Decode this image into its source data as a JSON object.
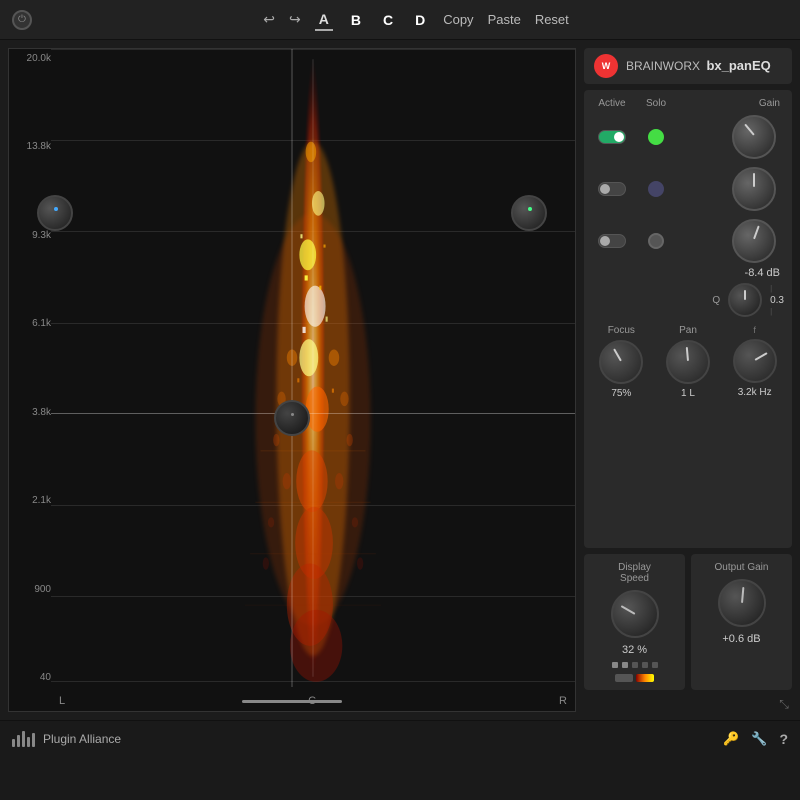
{
  "topBar": {
    "undo_label": "↩",
    "redo_label": "↪",
    "preset_a": "A",
    "preset_b": "B",
    "preset_c": "C",
    "preset_d": "D",
    "copy_label": "Copy",
    "paste_label": "Paste",
    "reset_label": "Reset"
  },
  "brand": {
    "logo_text": "W",
    "name": "BRAINWORX",
    "plugin": "bx_panEQ"
  },
  "eqDisplay": {
    "freq_labels": [
      "20.0k",
      "13.8k",
      "9.3k",
      "6.1k",
      "3.8k",
      "2.1k",
      "900",
      "40"
    ],
    "pan_labels": [
      "L",
      "C",
      "R"
    ],
    "crosshair_y_pct": 55
  },
  "bands": {
    "header": {
      "active": "Active",
      "solo": "Solo",
      "gain": "Gain"
    },
    "rows": [
      {
        "active": true,
        "solo": false,
        "solo_color": "green",
        "gain_deg": -40
      },
      {
        "active": false,
        "solo": true,
        "solo_color": "blue",
        "gain_deg": 0
      },
      {
        "active": false,
        "solo": false,
        "solo_color": "white",
        "gain_deg": 20
      }
    ],
    "gain_value": "-8.4 dB"
  },
  "q": {
    "label": "Q",
    "value": "0.3",
    "knob_deg": 0
  },
  "fpf": {
    "focus": {
      "label": "Focus",
      "value": "75%",
      "knob_deg": -30
    },
    "pan": {
      "label": "Pan",
      "value": "1 L",
      "knob_deg": -5
    },
    "freq": {
      "label": "",
      "value": "3.2k Hz",
      "knob_deg": 60
    }
  },
  "displaySpeed": {
    "label": "Display\nSpeed",
    "value": "32 %",
    "knob_deg": -60
  },
  "outputGain": {
    "label": "Output Gain",
    "value": "+0.6 dB",
    "knob_deg": 5
  },
  "bottomBar": {
    "logo_text": "Plugin Alliance",
    "icon_key": "🔑",
    "icon_tool": "🔧",
    "icon_help": "?"
  },
  "colors": {
    "accent": "#e44",
    "active_green": "#2a6",
    "bg_dark": "#111",
    "bg_mid": "#222",
    "bg_panel": "#2a2a2a",
    "knob_border": "#444",
    "text_primary": "#ddd",
    "text_secondary": "#999"
  }
}
